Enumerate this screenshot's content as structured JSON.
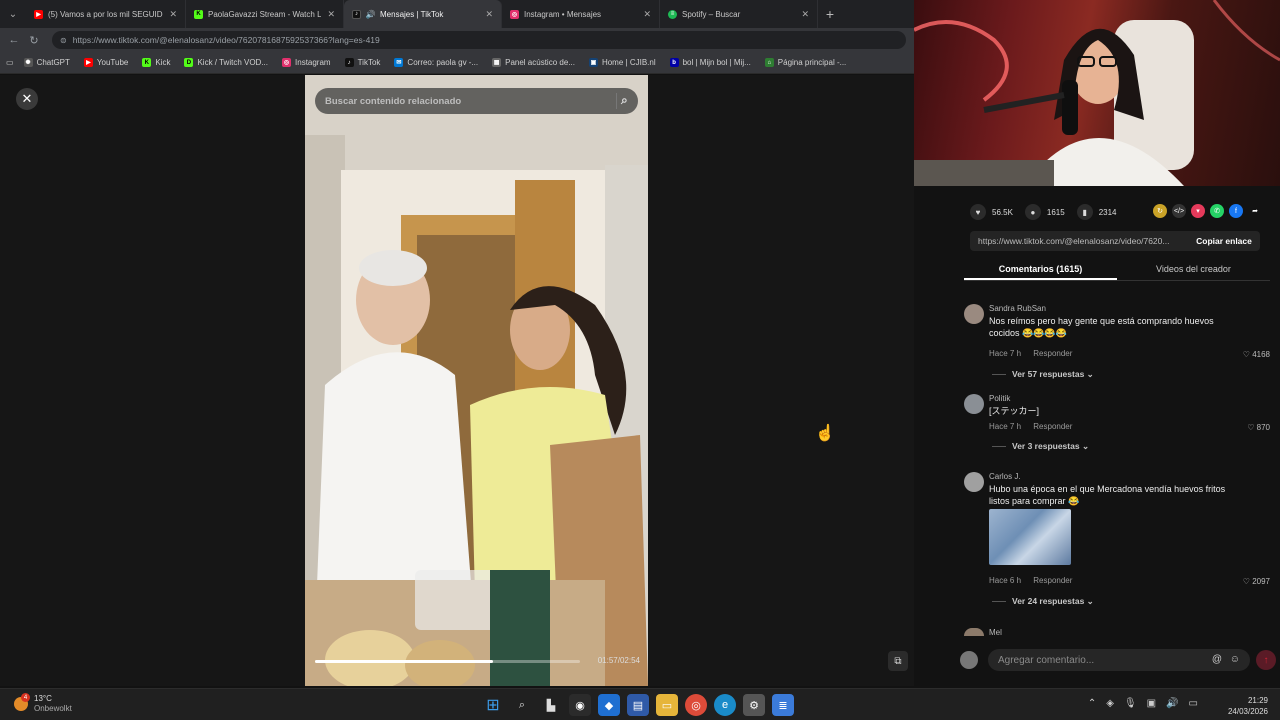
{
  "browser": {
    "tabs": [
      {
        "label": "(5) Vamos a por los mil SEGUIDORES",
        "icon": "youtube-icon",
        "color": "#ff0000",
        "active": false
      },
      {
        "label": "PaolaGavazzi Stream - Watch Live",
        "icon": "kick-icon",
        "color": "#53fc18",
        "active": false
      },
      {
        "label": "Mensajes | TikTok",
        "icon": "tiktok-icon",
        "color": "#000000",
        "active": true
      },
      {
        "label": "Instagram • Mensajes",
        "icon": "instagram-icon",
        "color": "#e1306c",
        "active": false
      },
      {
        "label": "Spotify – Buscar",
        "icon": "spotify-icon",
        "color": "#1db954",
        "active": false
      }
    ],
    "url": "https://www.tiktok.com/@elenalosanz/video/7620781687592537366?lang=es-419",
    "bookmarks": [
      {
        "label": "ChatGPT",
        "color": "#555555"
      },
      {
        "label": "YouTube",
        "color": "#ff0000"
      },
      {
        "label": "Kick",
        "color": "#53fc18"
      },
      {
        "label": "Kick / Twitch VOD...",
        "color": "#53fc18"
      },
      {
        "label": "Instagram",
        "color": "#e1306c"
      },
      {
        "label": "TikTok",
        "color": "#111111"
      },
      {
        "label": "Correo: paola gv -...",
        "color": "#0078d4"
      },
      {
        "label": "Panel acústico de...",
        "color": "#666666"
      },
      {
        "label": "Home | CJIB.nl",
        "color": "#154273"
      },
      {
        "label": "bol | Mijn bol | Mij...",
        "color": "#0000a4"
      },
      {
        "label": "Página principal -...",
        "color": "#2e7d32"
      }
    ]
  },
  "video": {
    "search_placeholder": "Buscar contenido relacionado",
    "timecode": "01:57/02:54",
    "progress": 0.67
  },
  "panel": {
    "likes": "56.5K",
    "comments_count": "1615",
    "saves": "2314",
    "link": "https://www.tiktok.com/@elenalosanz/video/7620...",
    "copy_label": "Copiar enlace",
    "tab_comments": "Comentarios (1615)",
    "tab_creator": "Videos del creador",
    "comments": [
      {
        "name": "Sandra RubSan",
        "text": "Nos reímos pero hay gente que está comprando huevos cocidos 😂😂😂😂",
        "time": "Hace 7 h",
        "reply": "Responder",
        "likes": "4168",
        "replies": "Ver 57 respuestas"
      },
      {
        "name": "Politik",
        "text": "[ステッカー]",
        "time": "Hace 7 h",
        "reply": "Responder",
        "likes": "870",
        "replies": "Ver 3 respuestas"
      },
      {
        "name": "Carlos J.",
        "text": "Hubo una época en el que Mercadona vendía huevos fritos listos para comprar 😂",
        "time": "Hace 6 h",
        "reply": "Responder",
        "likes": "2097",
        "replies": "Ver 24 respuestas"
      },
      {
        "name": "Mel"
      }
    ],
    "composer_placeholder": "Agregar comentario..."
  },
  "taskbar": {
    "temp": "13°C",
    "weather": "Onbewolkt",
    "badge": "4",
    "time": "21:29",
    "date": "24/03/2026"
  }
}
